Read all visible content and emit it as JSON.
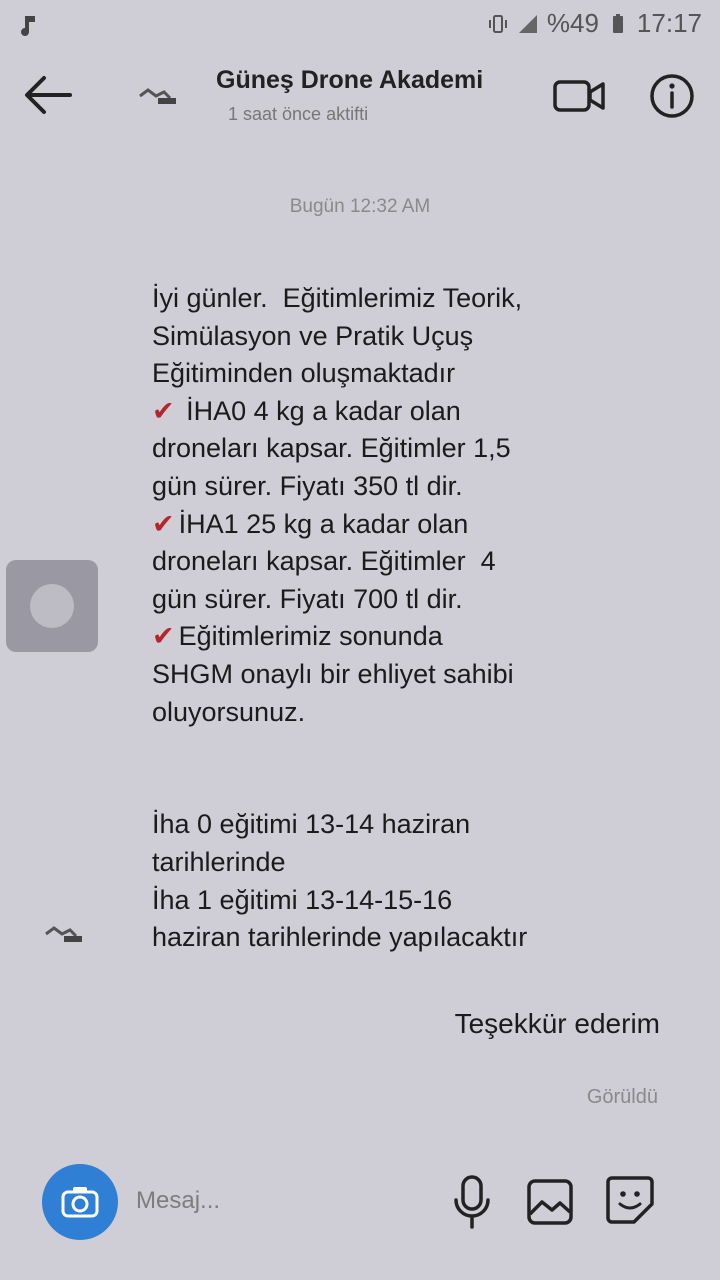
{
  "status_bar": {
    "battery_text": "%49",
    "time": "17:17",
    "icons": [
      "notification-icon",
      "vibrate-icon",
      "signal-icon",
      "battery-icon"
    ]
  },
  "header": {
    "title": "Güneş Drone Akademi",
    "subtitle": "1 saat önce aktifti",
    "icons": [
      "back-arrow-icon",
      "video-call-icon",
      "info-icon"
    ]
  },
  "conversation": {
    "timestamp": "Bugün 12:32 AM",
    "incoming_message": {
      "lines": [
        {
          "bullet": "",
          "text": "İyi günler.  Eğitimlerimiz Teorik,"
        },
        {
          "bullet": "",
          "text": "Simülasyon ve Pratik Uçuş"
        },
        {
          "bullet": "",
          "text": "Eğitiminden oluşmaktadır"
        },
        {
          "bullet": "✔",
          "text": " İHA0 4 kg a kadar olan"
        },
        {
          "bullet": "",
          "text": "droneları kapsar. Eğitimler 1,5"
        },
        {
          "bullet": "",
          "text": "gün sürer. Fiyatı 350 tl dir."
        },
        {
          "bullet": "✔",
          "text": "İHA1 25 kg a kadar olan"
        },
        {
          "bullet": "",
          "text": "droneları kapsar. Eğitimler  4"
        },
        {
          "bullet": "",
          "text": "gün sürer. Fiyatı 700 tl dir."
        },
        {
          "bullet": "✔",
          "text": "Eğitimlerimiz sonunda"
        },
        {
          "bullet": "",
          "text": "SHGM onaylı bir ehliyet sahibi"
        },
        {
          "bullet": "",
          "text": "oluyorsunuz."
        },
        {
          "bullet": "",
          "text": ""
        },
        {
          "bullet": "",
          "text": ""
        },
        {
          "bullet": "",
          "text": "İha 0 eğitimi 13-14 haziran"
        },
        {
          "bullet": "",
          "text": "tarihlerinde"
        },
        {
          "bullet": "",
          "text": "İha 1 eğitimi 13-14-15-16"
        },
        {
          "bullet": "",
          "text": "haziran tarihlerinde yapılacaktır"
        }
      ]
    },
    "outgoing_message": "Teşekkür ederim",
    "seen_label": "Görüldü"
  },
  "composer": {
    "placeholder": "Mesaj...",
    "icons": [
      "camera-icon",
      "microphone-icon",
      "gallery-icon",
      "sticker-icon"
    ]
  },
  "colors": {
    "camera_button": "#2f7fd4",
    "bullet": "#b3262a"
  }
}
